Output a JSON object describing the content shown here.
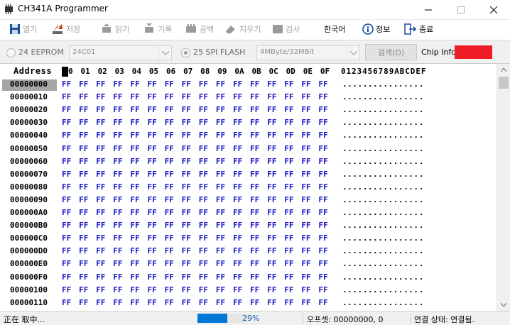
{
  "window": {
    "title": "CH341A Programmer",
    "min_glyph": "—",
    "max_glyph": "☐",
    "close_glyph": "✕"
  },
  "toolbar": {
    "open": "열기",
    "save": "저장",
    "read": "읽기",
    "write": "기록",
    "blank": "공백",
    "erase": "지우기",
    "verify": "검사",
    "language": "한국어",
    "info": "정보",
    "exit": "종료"
  },
  "options": {
    "eeprom_label": "24 EEPROM",
    "eeprom_value": "24C01",
    "spi_label": "25 SPI FLASH",
    "spi_value": "4MByte/32MBit",
    "search_label": "검색(D)",
    "chip_info_label": "Chip Info:"
  },
  "colors": {
    "hex_text": "#1919c8",
    "chip_info_box": "#ee1c25",
    "progress": "#0078d7",
    "selected_address": "#a6a6a6"
  },
  "hex": {
    "address_header": "Address",
    "columns": [
      "00",
      "01",
      "02",
      "03",
      "04",
      "05",
      "06",
      "07",
      "08",
      "09",
      "0A",
      "0B",
      "0C",
      "0D",
      "0E",
      "0F"
    ],
    "ascii_header": "0123456789ABCDEF",
    "rows": [
      {
        "addr": "00000000",
        "bytes": "FF FF FF FF FF FF FF FF FF FF FF FF FF FF FF FF",
        "ascii": "................"
      },
      {
        "addr": "00000010",
        "bytes": "FF FF FF FF FF FF FF FF FF FF FF FF FF FF FF FF",
        "ascii": "................"
      },
      {
        "addr": "00000020",
        "bytes": "FF FF FF FF FF FF FF FF FF FF FF FF FF FF FF FF",
        "ascii": "................"
      },
      {
        "addr": "00000030",
        "bytes": "FF FF FF FF FF FF FF FF FF FF FF FF FF FF FF FF",
        "ascii": "................"
      },
      {
        "addr": "00000040",
        "bytes": "FF FF FF FF FF FF FF FF FF FF FF FF FF FF FF FF",
        "ascii": "................"
      },
      {
        "addr": "00000050",
        "bytes": "FF FF FF FF FF FF FF FF FF FF FF FF FF FF FF FF",
        "ascii": "................"
      },
      {
        "addr": "00000060",
        "bytes": "FF FF FF FF FF FF FF FF FF FF FF FF FF FF FF FF",
        "ascii": "................"
      },
      {
        "addr": "00000070",
        "bytes": "FF FF FF FF FF FF FF FF FF FF FF FF FF FF FF FF",
        "ascii": "................"
      },
      {
        "addr": "00000080",
        "bytes": "FF FF FF FF FF FF FF FF FF FF FF FF FF FF FF FF",
        "ascii": "................"
      },
      {
        "addr": "00000090",
        "bytes": "FF FF FF FF FF FF FF FF FF FF FF FF FF FF FF FF",
        "ascii": "................"
      },
      {
        "addr": "000000A0",
        "bytes": "FF FF FF FF FF FF FF FF FF FF FF FF FF FF FF FF",
        "ascii": "................"
      },
      {
        "addr": "000000B0",
        "bytes": "FF FF FF FF FF FF FF FF FF FF FF FF FF FF FF FF",
        "ascii": "................"
      },
      {
        "addr": "000000C0",
        "bytes": "FF FF FF FF FF FF FF FF FF FF FF FF FF FF FF FF",
        "ascii": "................"
      },
      {
        "addr": "000000D0",
        "bytes": "FF FF FF FF FF FF FF FF FF FF FF FF FF FF FF FF",
        "ascii": "................"
      },
      {
        "addr": "000000E0",
        "bytes": "FF FF FF FF FF FF FF FF FF FF FF FF FF FF FF FF",
        "ascii": "................"
      },
      {
        "addr": "000000F0",
        "bytes": "FF FF FF FF FF FF FF FF FF FF FF FF FF FF FF FF",
        "ascii": "................"
      },
      {
        "addr": "00000100",
        "bytes": "FF FF FF FF FF FF FF FF FF FF FF FF FF FF FF FF",
        "ascii": "................"
      },
      {
        "addr": "00000110",
        "bytes": "FF FF FF FF FF FF FF FF FF FF FF FF FF FF FF FF",
        "ascii": "................"
      }
    ]
  },
  "status": {
    "message": "正在 取中...",
    "progress_percent": 29,
    "progress_label": "29%",
    "offset": "오프셋: 00000000, 0",
    "connection": "연결 상태: 연결됨."
  }
}
